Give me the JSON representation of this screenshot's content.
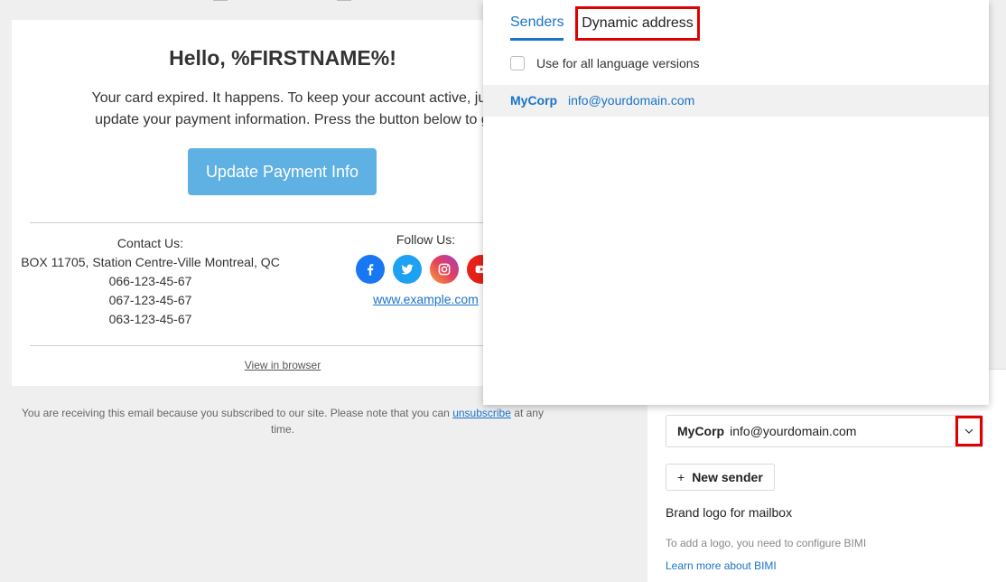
{
  "email": {
    "title": "Hello, %FIRSTNAME%!",
    "body_line1": "Your card expired. It happens. To keep your account active, just sign",
    "body_line2": "update your payment information. Press the button below to get sta",
    "cta_label": "Update Payment Info",
    "contact_heading": "Contact Us:",
    "contact_address": "BOX 11705, Station Centre-Ville Montreal, QC",
    "phones": [
      "066-123-45-67",
      "067-123-45-67",
      "063-123-45-67"
    ],
    "follow_heading": "Follow Us:",
    "social_icons": [
      "facebook-icon",
      "twitter-icon",
      "instagram-icon",
      "youtube-icon"
    ],
    "site_link": "www.example.com",
    "view_in_browser": "View in browser",
    "footer_before": "You are receiving this email because you subscribed to our site. Please note that you can",
    "footer_link": "unsubscribe",
    "footer_after": "at any",
    "footer_line2": "time."
  },
  "popup": {
    "tab_senders": "Senders",
    "tab_dynamic": "Dynamic address",
    "checkbox_label": "Use for all language versions",
    "checkbox_checked": false,
    "option_name": "MyCorp",
    "option_email": "info@yourdomain.com"
  },
  "settings": {
    "selected_name": "MyCorp",
    "selected_email": "info@yourdomain.com",
    "new_sender": "New sender",
    "new_sender_icon": "plus-icon",
    "brand_logo_label": "Brand logo for mailbox",
    "bimi_hint": "To add a logo, you need to configure BIMI",
    "bimi_link": "Learn more about BIMI"
  },
  "colors": {
    "accent": "#1a73c8",
    "cta": "#5fb0e3",
    "highlight": "#e00000",
    "facebook": "#1877f2",
    "twitter": "#1da1f2",
    "youtube": "#e62117"
  }
}
